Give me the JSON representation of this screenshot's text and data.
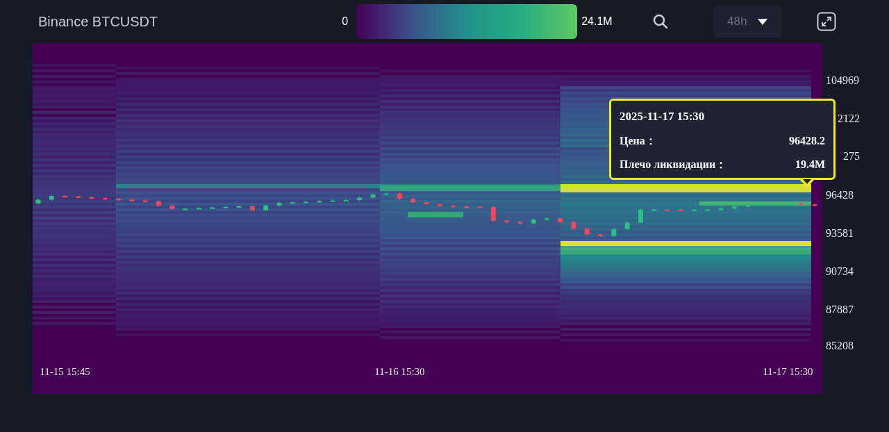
{
  "header": {
    "title": "Binance BTCUSDT",
    "legend": {
      "min": "0",
      "max": "24.1M"
    },
    "interval": {
      "value": "48h"
    }
  },
  "chart": {
    "axis_label_fragments": [
      "2122",
      "275"
    ],
    "chart_data": {
      "type": "candlestick",
      "categories": [
        null,
        null,
        "11-15 15:45",
        null,
        null,
        null,
        null,
        null,
        null,
        null,
        null,
        null,
        null,
        null,
        null,
        null,
        null,
        null,
        null,
        null,
        null,
        null,
        null,
        null,
        null,
        null,
        null,
        "11-16 15:30",
        null,
        null,
        null,
        null,
        null,
        null,
        null,
        null,
        null,
        null,
        null,
        null,
        null,
        null,
        null,
        null,
        null,
        null,
        null,
        null,
        null,
        null,
        null,
        null,
        null,
        null,
        null,
        null,
        "11-17 15:30",
        null,
        null
      ],
      "ylim": [
        81625,
        107763
      ],
      "yticks": [
        104969,
        96428,
        93581,
        90734,
        87887,
        85208
      ],
      "ohlc": [
        [
          95807,
          96160,
          95737,
          96090
        ],
        [
          96090,
          96440,
          96020,
          96370
        ],
        [
          96370,
          96440,
          96260,
          96330
        ],
        [
          96330,
          96400,
          96200,
          96270
        ],
        [
          96270,
          96340,
          96140,
          96210
        ],
        [
          96210,
          96280,
          96080,
          96150
        ],
        [
          96150,
          96220,
          96020,
          96090
        ],
        [
          96090,
          96160,
          95960,
          96030
        ],
        [
          96030,
          96100,
          95890,
          95960
        ],
        [
          95960,
          96030,
          95570,
          95640
        ],
        [
          95640,
          95710,
          95330,
          95400
        ],
        [
          95400,
          95490,
          95330,
          95420
        ],
        [
          95420,
          95540,
          95350,
          95470
        ],
        [
          95470,
          95580,
          95400,
          95510
        ],
        [
          95510,
          95630,
          95440,
          95560
        ],
        [
          95560,
          95670,
          95490,
          95600
        ],
        [
          95600,
          95670,
          95230,
          95300
        ],
        [
          95300,
          95720,
          95230,
          95650
        ],
        [
          95650,
          95930,
          95580,
          95860
        ],
        [
          95860,
          95970,
          95790,
          95900
        ],
        [
          95900,
          96010,
          95830,
          95940
        ],
        [
          95940,
          96060,
          95870,
          95990
        ],
        [
          95990,
          96100,
          95920,
          96030
        ],
        [
          96030,
          96130,
          95960,
          96060
        ],
        [
          96060,
          96320,
          95990,
          96250
        ],
        [
          96250,
          96550,
          96180,
          96480
        ],
        [
          96480,
          96630,
          96410,
          96560
        ],
        [
          96560,
          96630,
          96080,
          96150
        ],
        [
          96150,
          96220,
          95830,
          95900
        ],
        [
          95900,
          95970,
          95690,
          95760
        ],
        [
          95760,
          95830,
          95570,
          95640
        ],
        [
          95640,
          95710,
          95510,
          95580
        ],
        [
          95580,
          95650,
          95490,
          95560
        ],
        [
          95560,
          95630,
          95470,
          95540
        ],
        [
          95540,
          95610,
          94460,
          94530
        ],
        [
          94530,
          94600,
          94350,
          94420
        ],
        [
          94420,
          94490,
          94250,
          94320
        ],
        [
          94320,
          94670,
          94250,
          94600
        ],
        [
          94600,
          94770,
          94530,
          94700
        ],
        [
          94700,
          94770,
          94350,
          94420
        ],
        [
          94420,
          94490,
          93880,
          93950
        ],
        [
          93950,
          94020,
          93430,
          93500
        ],
        [
          93500,
          93570,
          93320,
          93390
        ],
        [
          93390,
          93970,
          93320,
          93900
        ],
        [
          93900,
          94450,
          93830,
          94380
        ],
        [
          94380,
          95410,
          94310,
          95340
        ],
        [
          95340,
          95420,
          95270,
          95350
        ],
        [
          95350,
          95420,
          95270,
          95340
        ],
        [
          95340,
          95410,
          95260,
          95330
        ],
        [
          95330,
          95410,
          95260,
          95340
        ],
        [
          95340,
          95420,
          95270,
          95350
        ],
        [
          95350,
          95500,
          95280,
          95430
        ],
        [
          95430,
          95650,
          95360,
          95580
        ],
        [
          95580,
          95770,
          95510,
          95700
        ],
        [
          95700,
          95830,
          95630,
          95760
        ],
        [
          95760,
          95900,
          95690,
          95830
        ],
        [
          95830,
          95910,
          95760,
          95840
        ],
        [
          95840,
          95910,
          95670,
          95740
        ],
        [
          95740,
          95810,
          95590,
          95660
        ]
      ]
    }
  },
  "tooltip": {
    "title": "2025-11-17 15:30",
    "rows": [
      {
        "label": "Цена：",
        "value": "96428.2"
      },
      {
        "label": "Плечо ликвидации：",
        "value": "19.4M"
      }
    ]
  }
}
